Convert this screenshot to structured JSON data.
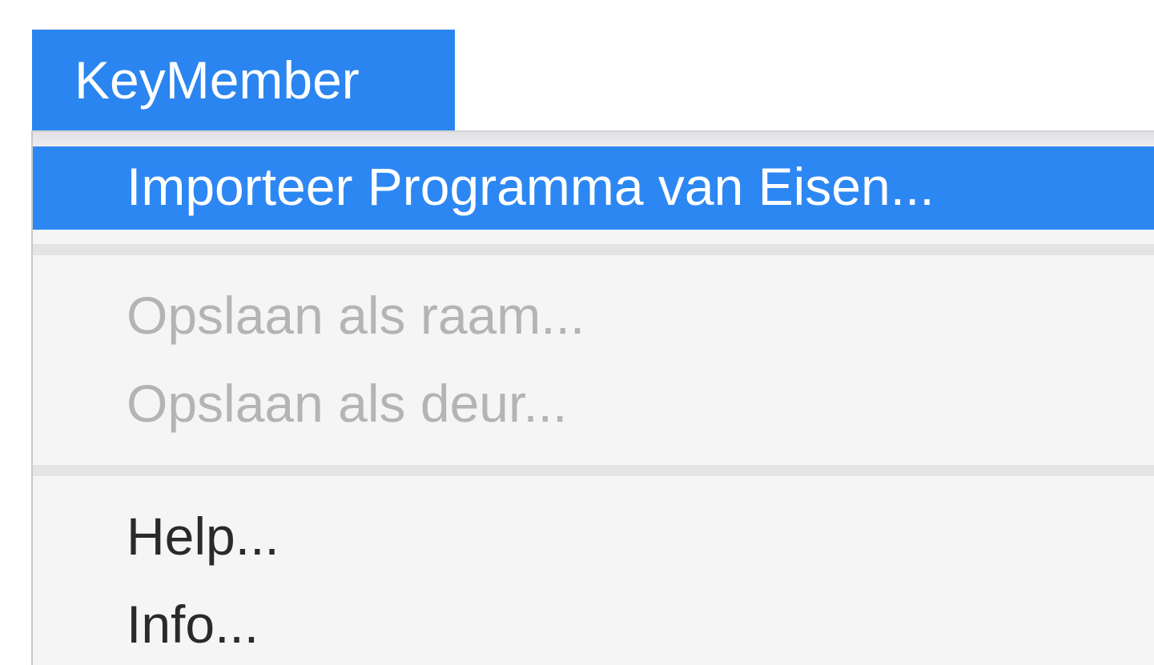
{
  "menubar": {
    "app_name": "KeyMember"
  },
  "menu": {
    "items": [
      {
        "label": "Importeer Programma van Eisen...",
        "state": "highlighted"
      },
      {
        "label": "Opslaan als raam...",
        "state": "disabled"
      },
      {
        "label": "Opslaan als deur...",
        "state": "disabled"
      },
      {
        "label": "Help...",
        "state": "enabled"
      },
      {
        "label": "Info...",
        "state": "enabled"
      }
    ]
  },
  "colors": {
    "highlight": "#2b85f0",
    "menu_background": "#f5f5f5",
    "disabled_text": "#b4b4b4",
    "enabled_text": "#2a2a2a"
  }
}
